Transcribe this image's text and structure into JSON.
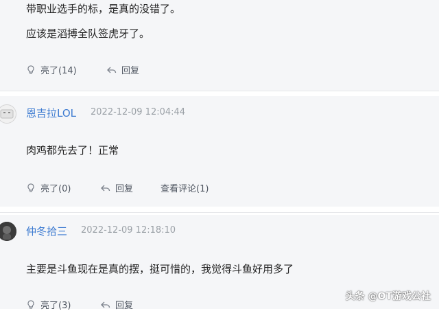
{
  "comment1": {
    "lines": [
      "带职业选手的标，是真的没错了。",
      "应该是滔搏全队签虎牙了。"
    ],
    "actions": {
      "like_icon": "bulb-icon",
      "like_label": "亮了(14)",
      "reply_icon": "reply-arrow-icon",
      "reply_label": "回复"
    }
  },
  "comment2": {
    "username": "恩吉拉LOL",
    "timestamp": "2022-12-09 12:04:44",
    "text": "肉鸡都先去了！正常",
    "actions": {
      "like_icon": "bulb-icon",
      "like_label": "亮了(0)",
      "reply_icon": "reply-arrow-icon",
      "reply_label": "回复",
      "view_label": "查看评论(1)"
    }
  },
  "comment3": {
    "username": "仲冬拾三",
    "timestamp": "2022-12-09 12:18:10",
    "text": "主要是斗鱼现在是真的摆，挺可惜的，我觉得斗鱼好用多了",
    "actions": {
      "like_icon": "bulb-icon",
      "like_label": "亮了(3)",
      "reply_icon": "reply-arrow-icon",
      "reply_label": "回复"
    }
  },
  "watermark": "头条 @OT游戏公社"
}
